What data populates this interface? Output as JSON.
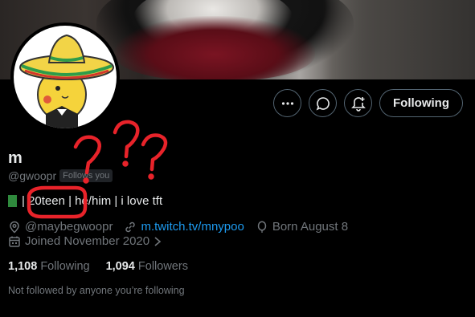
{
  "profile": {
    "name": "m",
    "handle": "@gwoopr",
    "follows_you_badge": "Follows you",
    "bio_text": " | 20teen | he/him | i love tft",
    "location": "@maybegwoopr",
    "website": "m.twitch.tv/mnypoo",
    "birthday": "Born August 8",
    "joined": "Joined November 2020",
    "following_count": "1,108",
    "following_label": "Following",
    "followers_count": "1,094",
    "followers_label": "Followers",
    "not_followed_text": "Not followed by anyone you’re following"
  },
  "actions": {
    "more_icon": "more-icon",
    "message_icon": "message-icon",
    "notify_icon": "bell-plus-icon",
    "following_button_label": "Following"
  },
  "colors": {
    "background": "#000000",
    "text_primary": "#e7e9ea",
    "text_secondary": "#71767b",
    "link": "#1d9bf0",
    "annotation": "#e8232a"
  }
}
